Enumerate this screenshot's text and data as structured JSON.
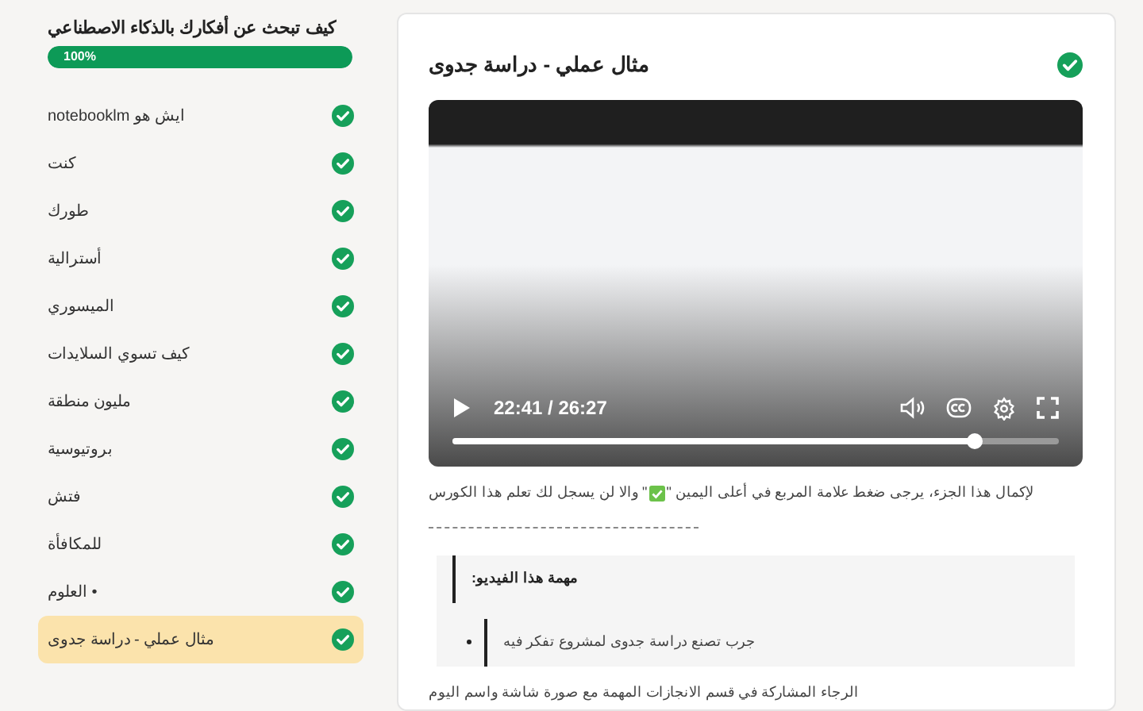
{
  "sidebar": {
    "course_title": "كيف تبحث عن أفكارك بالذكاء الاصطناعي",
    "progress": {
      "level": 1,
      "label": "100%"
    },
    "lessons": [
      {
        "title": "ايش هو notebooklm",
        "completed": true,
        "selected": false
      },
      {
        "title": "كنت",
        "completed": true,
        "selected": false
      },
      {
        "title": "طورك",
        "completed": true,
        "selected": false
      },
      {
        "title": "أسترالية",
        "completed": true,
        "selected": false
      },
      {
        "title": "الميسوري",
        "completed": true,
        "selected": false
      },
      {
        "title": "كيف تسوي السلايدات",
        "completed": true,
        "selected": false
      },
      {
        "title": "مليون منطقة",
        "completed": true,
        "selected": false
      },
      {
        "title": "بروتيوسية",
        "completed": true,
        "selected": false
      },
      {
        "title": "فتش",
        "completed": true,
        "selected": false
      },
      {
        "title": "للمكافأة",
        "completed": true,
        "selected": false
      },
      {
        "title": "• العلوم",
        "completed": true,
        "selected": false
      },
      {
        "title": "مثال عملي - دراسة جدوى",
        "completed": true,
        "selected": true
      }
    ]
  },
  "lesson": {
    "title": "مثال عملي - دراسة جدوى",
    "completed": true,
    "video": {
      "time": "22:41 / 26:27",
      "level": 0.86
    },
    "instruction_before": "لإكمال هذا الجزء، يرجى ضغط علامة المربع في أعلى اليمين \"",
    "instruction_after": "\" والا لن يسجل لك تعلم هذا الكورس",
    "task_heading": "مهمة هذا الفيديو:",
    "task_items": [
      "جرب تصنع دراسة جدوى لمشروع تفكر فيه"
    ],
    "closing": "الرجاء المشاركة في قسم الانجازات المهمة مع صورة شاشة واسم اليوم"
  }
}
